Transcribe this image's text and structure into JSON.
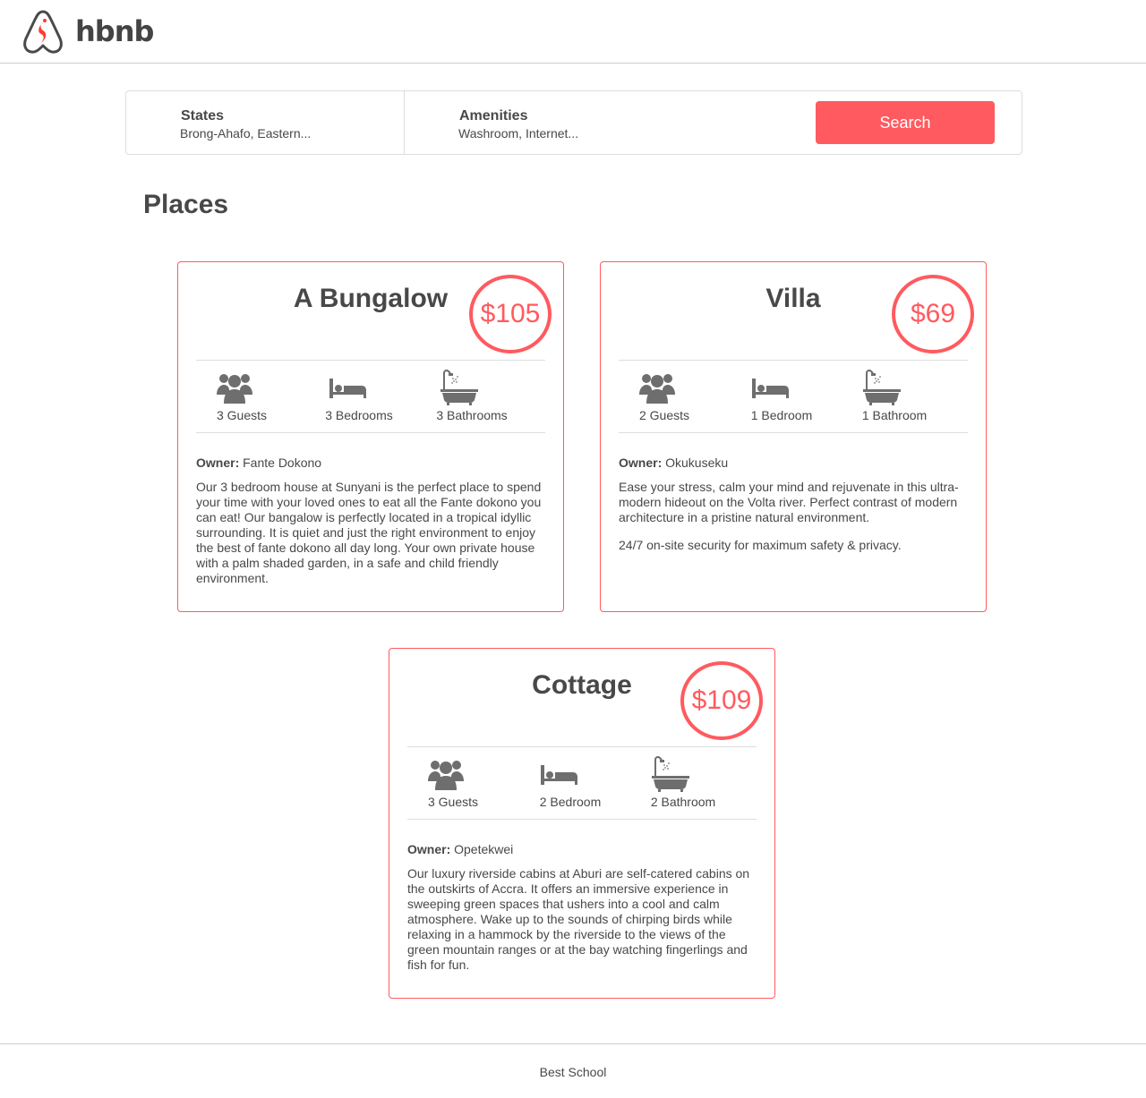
{
  "header": {
    "logo_text": "hbnb"
  },
  "filters": {
    "states": {
      "title": "States",
      "selected": "Brong-Ahafo, Eastern..."
    },
    "amenities": {
      "title": "Amenities",
      "selected": "Washroom, Internet..."
    },
    "search_label": "Search"
  },
  "places_title": "Places",
  "places": [
    {
      "name": "A Bungalow",
      "price": "$105",
      "guests": "3 Guests",
      "rooms": "3 Bedrooms",
      "baths": "3 Bathrooms",
      "owner_label": "Owner:",
      "owner": " Fante Dokono",
      "description": [
        "Our 3 bedroom house at Sunyani is the perfect place to spend your time with your loved ones to eat all the Fante dokono you can eat! Our bangalow is perfectly located in a tropical idyllic surrounding. It is quiet and just the right environment to enjoy the best of fante dokono all day long. Your own private house with a palm shaded garden, in a safe and child friendly environment."
      ]
    },
    {
      "name": "Villa",
      "price": "$69",
      "guests": "2 Guests",
      "rooms": "1 Bedroom",
      "baths": "1 Bathroom",
      "owner_label": "Owner:",
      "owner": " Okukuseku",
      "description": [
        "Ease your stress, calm your mind and rejuvenate in this ultra-modern hideout on the Volta river. Perfect contrast of modern architecture in a pristine natural environment.",
        "24/7 on-site security for maximum safety & privacy."
      ]
    },
    {
      "name": "Cottage",
      "price": "$109",
      "guests": "3 Guests",
      "rooms": "2 Bedroom",
      "baths": "2 Bathroom",
      "owner_label": "Owner:",
      "owner": " Opetekwei",
      "description": [
        "Our luxury riverside cabins at Aburi are self-catered cabins on the outskirts of Accra. It offers an immersive experience in sweeping green spaces that ushers into a cool and calm atmosphere. Wake up to the sounds of chirping birds while relaxing in a hammock by the riverside to the views of the green mountain ranges or at the bay watching fingerlings and fish for fun."
      ]
    }
  ],
  "icons": {
    "logo": "hbnb-logo-icon",
    "guests": "group-icon",
    "rooms": "bed-icon",
    "baths": "bathtub-icon"
  },
  "colors": {
    "accent": "#ff5a5f",
    "text": "#484848",
    "border": "#dddddd"
  },
  "footer": {
    "text": "Best School"
  }
}
